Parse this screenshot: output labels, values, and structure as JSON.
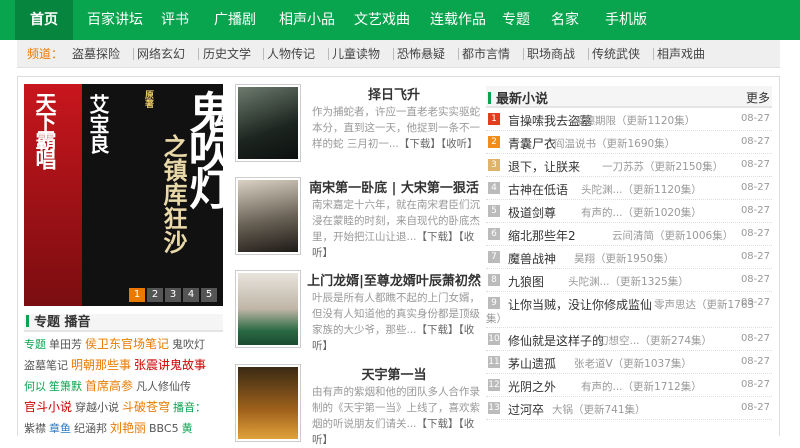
{
  "nav": {
    "items": [
      "首页",
      "百家讲坛",
      "评书",
      "广播剧",
      "相声小品",
      "文艺戏曲",
      "连载作品",
      "专题",
      "名家",
      "手机版"
    ],
    "active_index": 0,
    "color": "#08a44e"
  },
  "channels": {
    "label": "频道：",
    "items": [
      "盗墓探险",
      "网络玄幻",
      "历史文学",
      "人物传记",
      "儿童读物",
      "恐怖悬疑",
      "都市言情",
      "职场商战",
      "传统武侠",
      "相声戏曲"
    ]
  },
  "poster": {
    "side_text": "天下霸唱",
    "author": "艾宝良",
    "title": "鬼吹灯",
    "subtitle": "之镇库狂沙",
    "badge": "原著",
    "pages": [
      "1",
      "2",
      "3",
      "4",
      "5"
    ],
    "active_page": 0
  },
  "topic": {
    "heading": "专题 播音",
    "tags": [
      {
        "t": "专题",
        "c": "#08a44e"
      },
      {
        "t": "单田芳",
        "c": "#555"
      },
      {
        "t": "侯卫东官场笔记",
        "c": "#e87a00"
      },
      {
        "t": "鬼吹灯",
        "c": "#555"
      },
      {
        "t": "盗墓笔记",
        "c": "#555"
      },
      {
        "t": "明朝那些事",
        "c": "#e87a00"
      },
      {
        "t": "张震讲鬼故事",
        "c": "#c00"
      },
      {
        "t": "何以",
        "c": "#08a44e"
      },
      {
        "t": "笙箫默",
        "c": "#08a44e"
      },
      {
        "t": "首席高参",
        "c": "#e87a00"
      },
      {
        "t": "凡人修仙传",
        "c": "#555"
      },
      {
        "t": "官斗小说",
        "c": "#c00"
      },
      {
        "t": "穿越小说",
        "c": "#555"
      },
      {
        "t": "斗破苍穹",
        "c": "#e87a00"
      },
      {
        "t": "播音：",
        "c": "#08a44e"
      },
      {
        "t": "紫襟",
        "c": "#555"
      },
      {
        "t": "章鱼",
        "c": "#2a7ac0"
      },
      {
        "t": "纪涵邦",
        "c": "#555"
      },
      {
        "t": "刘艳丽",
        "c": "#e87a00"
      },
      {
        "t": "BBC5",
        "c": "#555"
      },
      {
        "t": "黄",
        "c": "#08a44e"
      }
    ]
  },
  "books": [
    {
      "title": "择日飞升",
      "desc": "作为捕蛇者，许应一直老老实实驱蛇本分，直到这一天，他捉到一条不一样的蛇 三月初一...",
      "dl": "【下载】",
      "fav": "【收听】"
    },
    {
      "title": "南宋第一卧底 | 大宋第一狠活",
      "desc": "南宋嘉定十六年，就在南宋君臣们沉浸在蒙睦的时刻，来自现代的卧底杰里，开始把江山让退...",
      "dl": "【下载】",
      "fav": "【收听】"
    },
    {
      "title": "上门龙婿|至尊龙婿叶辰萧初然",
      "desc": "叶辰是所有人都瞧不起的上门女婿，但没有人知道他的真实身份都是顶级家族的大少爷，那些...",
      "dl": "【下载】",
      "fav": "【收听】"
    },
    {
      "title": "天宇第一当",
      "desc": "由有声的紫烟和他的团队多人合作录制的《天宇第一当》上线了，喜欢紫烟的听说朋友们请关...",
      "dl": "【下载】",
      "fav": "【收听】"
    }
  ],
  "latest": {
    "heading": "最新小说",
    "more": "更多",
    "rows": [
      {
        "num": "1",
        "name": "盲操嗦我去盗墓",
        "info": "凌德期限（更新1120集）",
        "date": "08-27",
        "c": "#e23d1f"
      },
      {
        "num": "2",
        "name": "青囊尸衣",
        "info": "阎温说书（更新1690集）",
        "date": "08-27",
        "c": "#f08c1c"
      },
      {
        "num": "3",
        "name": "退下，让朕来",
        "info": "一刀苏苏（更新2150集）",
        "date": "08-27",
        "c": "#e0b36a"
      },
      {
        "num": "4",
        "name": "古神在低语",
        "info": "头陀渊...（更新1120集）",
        "date": "08-27",
        "c": "#bbb"
      },
      {
        "num": "5",
        "name": "极道剑尊",
        "info": "有声的...（更新1020集）",
        "date": "08-27",
        "c": "#bbb"
      },
      {
        "num": "6",
        "name": "缩北那些年2",
        "info": "云间清简（更新1006集）",
        "date": "08-27",
        "c": "#bbb"
      },
      {
        "num": "7",
        "name": "魔兽战神",
        "info": "昊翔（更新1950集）",
        "date": "08-27",
        "c": "#bbb"
      },
      {
        "num": "8",
        "name": "九狼图",
        "info": "头陀渊...（更新1325集）",
        "date": "08-27",
        "c": "#bbb"
      },
      {
        "num": "9",
        "name": "让你当贼，没让你修成监仙",
        "info": "零声思达（更新1763",
        "cont": "集）",
        "date": "08-27",
        "c": "#bbb"
      },
      {
        "num": "10",
        "name": "修仙就是这样子的",
        "info": "幻想空...（更新274集）",
        "date": "08-27",
        "c": "#bbb"
      },
      {
        "num": "11",
        "name": "茅山遗孤",
        "info": "张老道V（更新1037集）",
        "date": "08-27",
        "c": "#bbb"
      },
      {
        "num": "12",
        "name": "光阴之外",
        "info": "有声的...（更新1712集）",
        "date": "08-27",
        "c": "#bbb"
      },
      {
        "num": "13",
        "name": "过河卒",
        "info": "大锅（更新741集）",
        "date": "08-27",
        "c": "#bbb"
      }
    ]
  }
}
